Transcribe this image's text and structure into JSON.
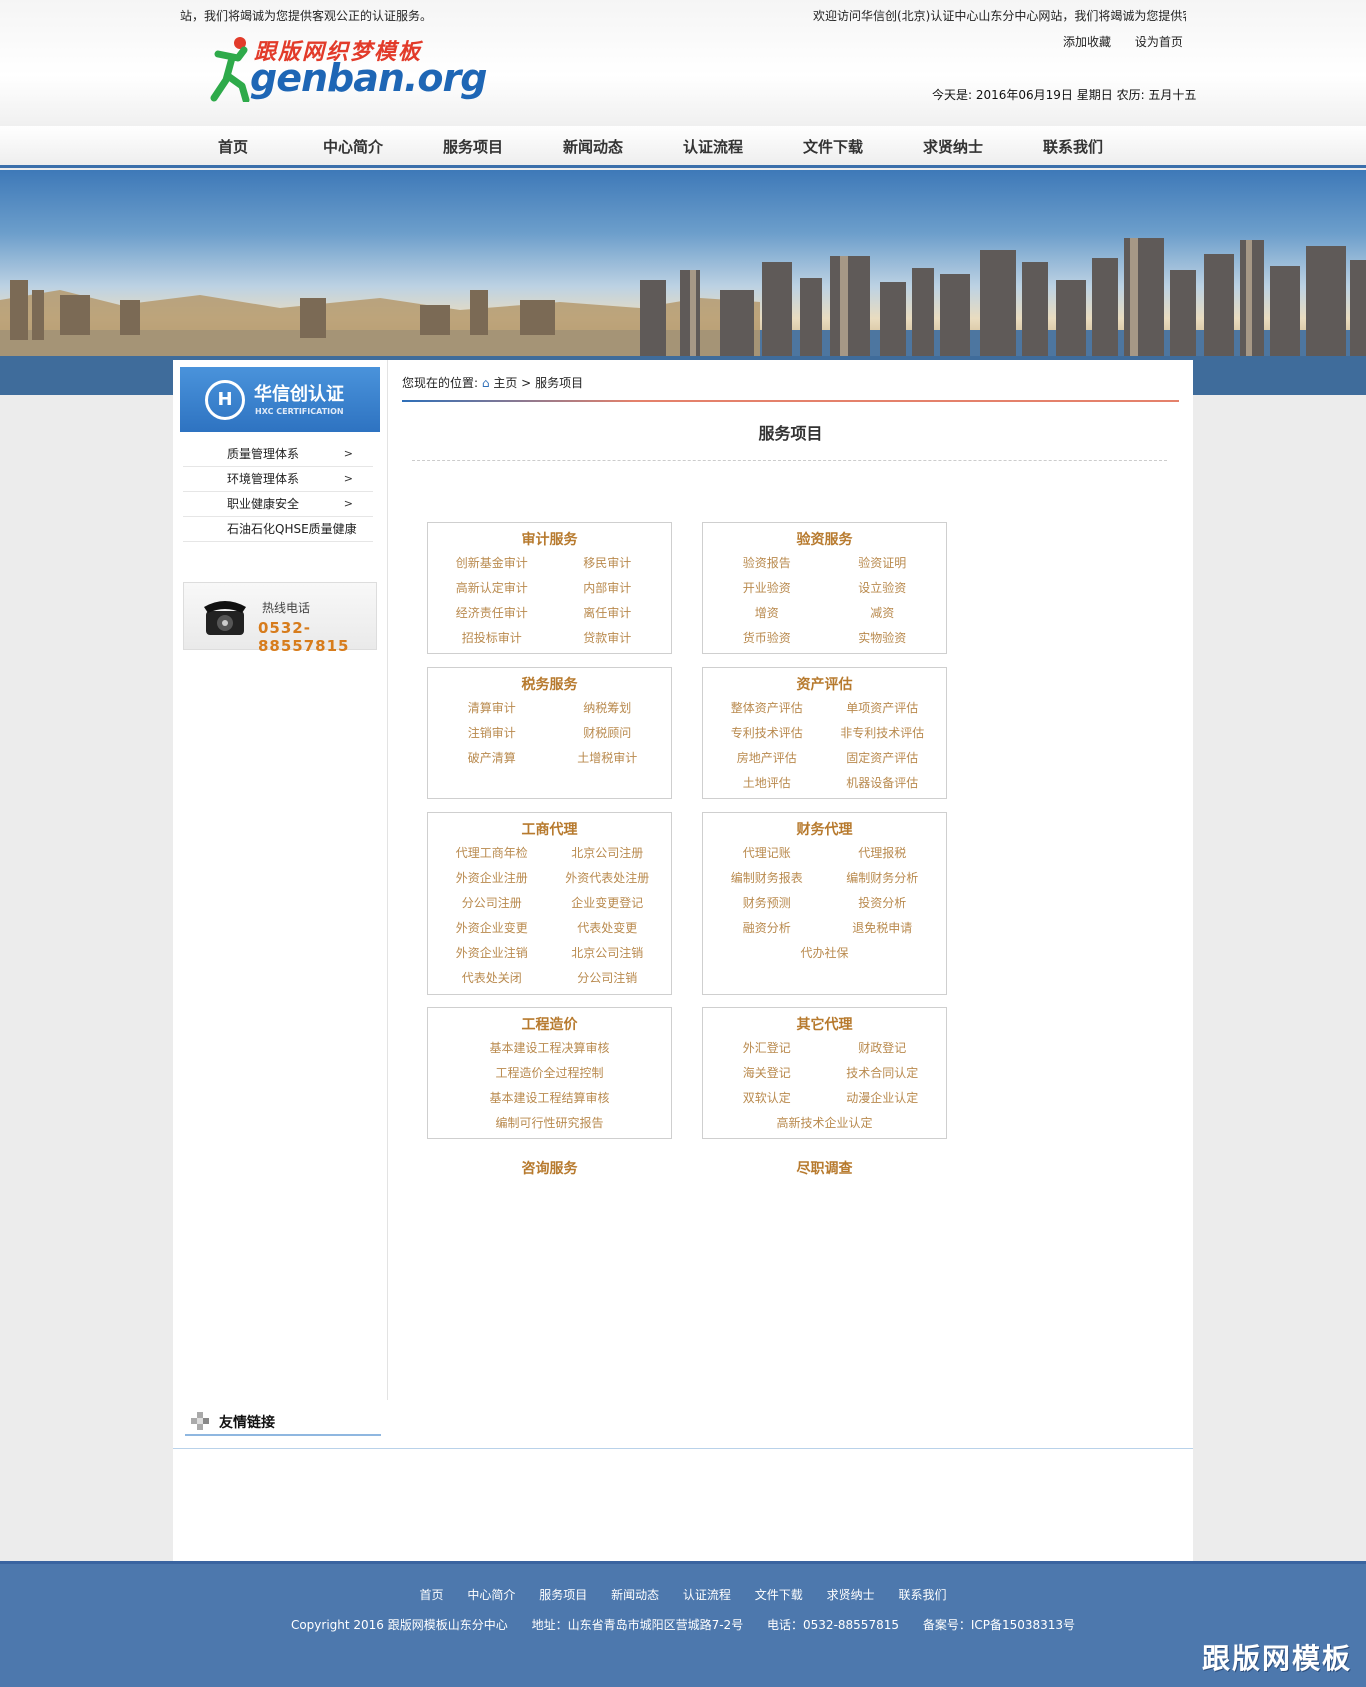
{
  "header": {
    "marquee_left": "站，我们将竭诚为您提供客观公正的认证服务。",
    "marquee_right": "欢迎访问华信创(北京)认证中心山东分中心网站，我们将竭诚为您提供客",
    "add_favorite": "添加收藏",
    "set_homepage": "设为首页",
    "today": "今天是: 2016年06月19日 星期日 农历: 五月十五",
    "logo_cn": "跟版网织梦模板",
    "logo_en": "genban.org"
  },
  "nav": {
    "items": [
      "首页",
      "中心简介",
      "服务项目",
      "新闻动态",
      "认证流程",
      "文件下载",
      "求贤纳士",
      "联系我们"
    ]
  },
  "sidebar": {
    "brand_cn": "华信创认证",
    "brand_en": "HXC CERTIFICATION",
    "brand_mark": "H",
    "menu": [
      "质量管理体系",
      "环境管理体系",
      "职业健康安全",
      "石油石化QHSE质量健康"
    ],
    "arrow": ">",
    "hotline_label": "热线电话",
    "hotline_number": "0532-88557815"
  },
  "content": {
    "breadcrumb_prefix": "您现在的位置:",
    "breadcrumb_home": "主页",
    "breadcrumb_sep": ">",
    "breadcrumb_current": "服务项目",
    "page_title": "服务项目",
    "boxes": [
      {
        "title": "审计服务",
        "items": [
          "创新基金审计",
          "移民审计",
          "高新认定审计",
          "内部审计",
          "经济责任审计",
          "离任审计",
          "招投标审计",
          "贷款审计"
        ]
      },
      {
        "title": "验资服务",
        "items": [
          "验资报告",
          "验资证明",
          "开业验资",
          "设立验资",
          "增资",
          "减资",
          "货币验资",
          "实物验资"
        ]
      },
      {
        "title": "税务服务",
        "items": [
          "清算审计",
          "纳税筹划",
          "注销审计",
          "财税顾问",
          "破产清算",
          "土增税审计"
        ]
      },
      {
        "title": "资产评估",
        "items": [
          "整体资产评估",
          "单项资产评估",
          "专利技术评估",
          "非专利技术评估",
          "房地产评估",
          "固定资产评估",
          "土地评估",
          "机器设备评估"
        ]
      },
      {
        "title": "工商代理",
        "items": [
          "代理工商年检",
          "北京公司注册",
          "外资企业注册",
          "外资代表处注册",
          "分公司注册",
          "企业变更登记",
          "外资企业变更",
          "代表处变更",
          "外资企业注销",
          "北京公司注销",
          "代表处关闭",
          "分公司注销"
        ]
      },
      {
        "title": "财务代理",
        "items": [
          "代理记账",
          "代理报税",
          "编制财务报表",
          "编制财务分析",
          "财务预测",
          "投资分析",
          "融资分析",
          "退免税申请",
          "代办社保"
        ]
      },
      {
        "title": "工程造价",
        "items": [
          "基本建设工程决算审核",
          "工程造价全过程控制",
          "基本建设工程结算审核",
          "编制可行性研究报告"
        ]
      },
      {
        "title": "其它代理",
        "items": [
          "外汇登记",
          "财政登记",
          "海关登记",
          "技术合同认定",
          "双软认定",
          "动漫企业认定",
          "高新技术企业认定"
        ]
      }
    ],
    "bare_titles": [
      "咨询服务",
      "尽职调查"
    ]
  },
  "friend_links": {
    "title": "友情链接"
  },
  "footer": {
    "nav": [
      "首页",
      "中心简介",
      "服务项目",
      "新闻动态",
      "认证流程",
      "文件下载",
      "求贤纳士",
      "联系我们"
    ],
    "copyright": "Copyright 2016 跟版网模板山东分中心",
    "address": "地址：山东省青岛市城阳区营城路7-2号",
    "phone": "电话：0532-88557815",
    "icp": "备案号：ICP备15038313号",
    "watermark": "跟版网模板"
  }
}
